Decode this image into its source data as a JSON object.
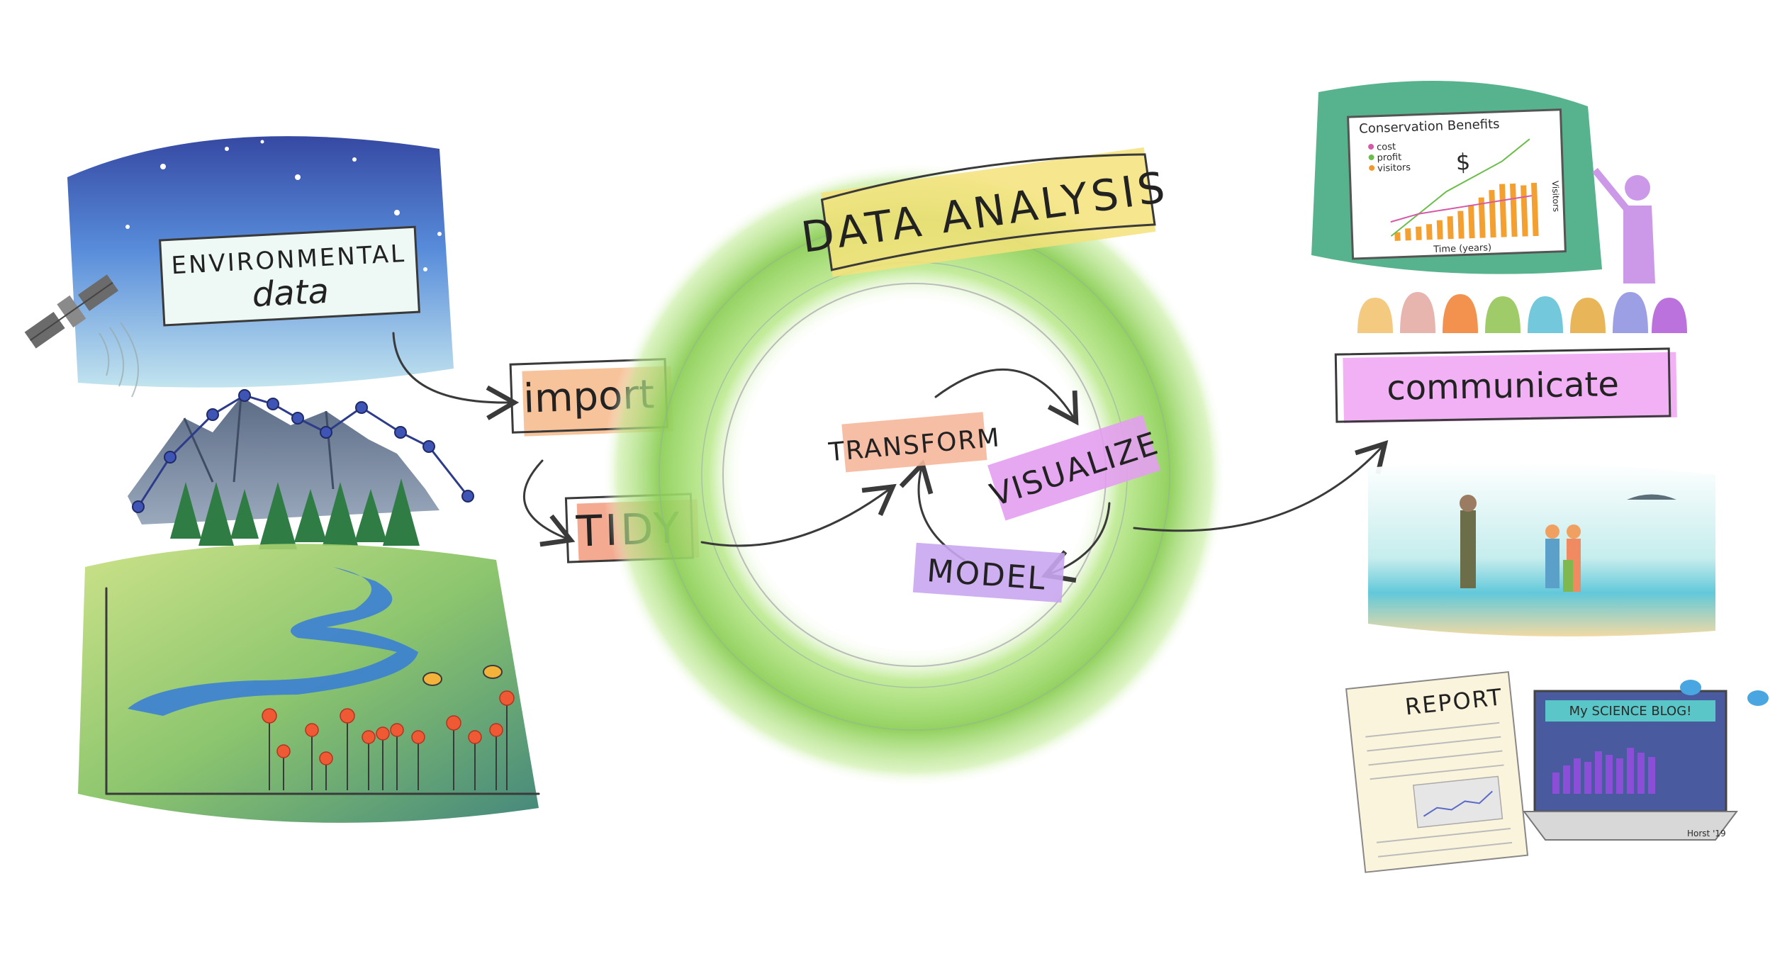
{
  "left": {
    "title_line1": "ENVIRONMENTAL",
    "title_line2": "data"
  },
  "steps": {
    "import": "import",
    "tidy": "TIDY"
  },
  "analysis": {
    "banner": "DATA ANALYSIS",
    "transform": "TRANSFORM",
    "visualize": "VISUALIZE",
    "model": "MODEL"
  },
  "communicate": {
    "label": "communicate",
    "chart": {
      "title": "Conservation Benefits",
      "legend": [
        "cost",
        "profit",
        "visitors"
      ],
      "xlabel": "Time (years)",
      "ylabel": "Visitors",
      "currency_symbol": "$"
    },
    "report_title": "REPORT",
    "blog_title": "My SCIENCE BLOG!",
    "signature": "Horst '19"
  },
  "colors": {
    "import_bg": "#f6b98a",
    "tidy_bg": "#f2a184",
    "transform_bg": "#f6b79c",
    "visualize_bg": "#e39ef0",
    "model_bg": "#c9a6f0",
    "communicate_bg": "#f0a3f2",
    "ring": "#9ed66a",
    "banner": "#f5e27a"
  }
}
